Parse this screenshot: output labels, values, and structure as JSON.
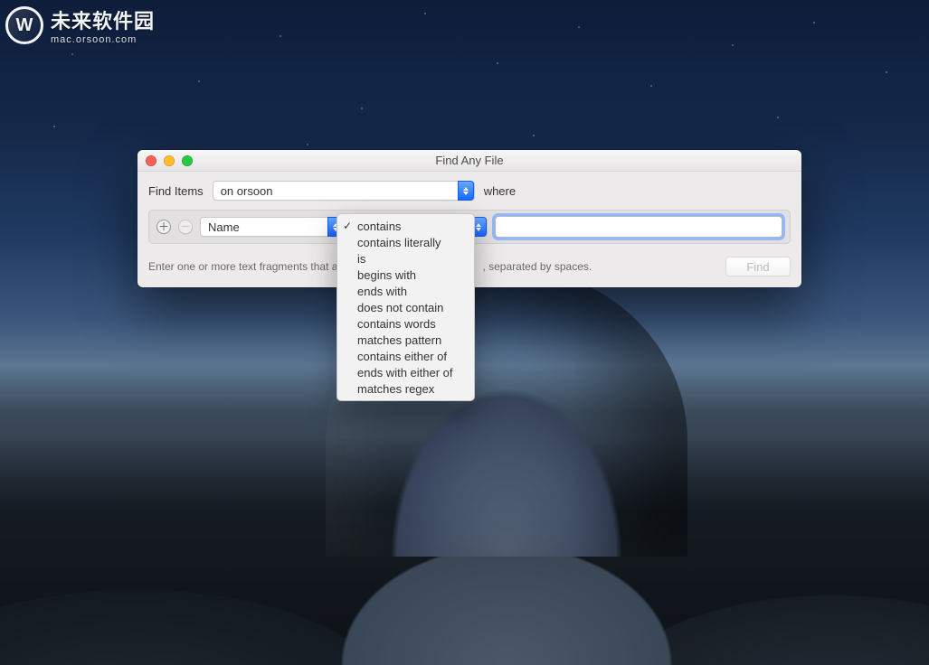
{
  "watermark": {
    "line1": "未来软件园",
    "line2": "mac.orsoon.com",
    "icon_letter": "W"
  },
  "window": {
    "title": "Find Any File",
    "find_items_label": "Find Items",
    "location_selected": "on orsoon",
    "where_label": "where",
    "criteria_field_selected": "Name",
    "search_value": "",
    "hint_before": "Enter one or more text fragments that all",
    "hint_after": ", separated by spaces.",
    "find_button_label": "Find"
  },
  "match_menu": {
    "selected_index": 0,
    "options": [
      "contains",
      "contains literally",
      "is",
      "begins with",
      "ends with",
      "does not contain",
      "contains words",
      "matches pattern",
      "contains either of",
      "ends with either of",
      "matches regex"
    ]
  }
}
